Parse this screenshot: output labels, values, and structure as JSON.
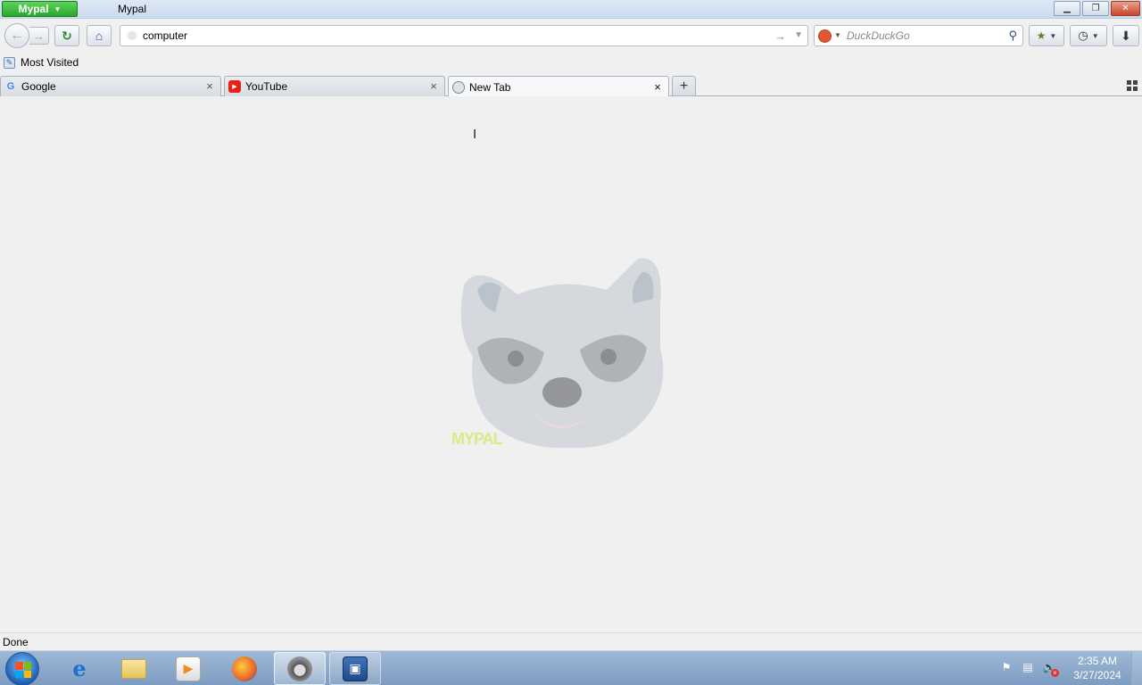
{
  "window": {
    "app_menu_label": "Mypal",
    "title": "Mypal"
  },
  "nav": {
    "url_value": "computer",
    "search_engine": "DuckDuckGo",
    "search_placeholder": "DuckDuckGo"
  },
  "bookmarks": {
    "items": [
      {
        "label": "Most Visited",
        "icon": "bookmark-folder-icon"
      }
    ]
  },
  "tabs": [
    {
      "label": "Google",
      "icon": "google-icon",
      "active": false
    },
    {
      "label": "YouTube",
      "icon": "youtube-icon",
      "active": false
    },
    {
      "label": "New Tab",
      "icon": "globe-icon",
      "active": true
    }
  ],
  "content": {
    "watermark": "MYPAL",
    "mascot": "raccoon-mascot"
  },
  "status": {
    "text": "Done"
  },
  "taskbar": {
    "apps": [
      {
        "name": "internet-explorer-icon",
        "state": "pinned"
      },
      {
        "name": "file-explorer-icon",
        "state": "pinned"
      },
      {
        "name": "media-player-icon",
        "state": "pinned"
      },
      {
        "name": "firefox-icon",
        "state": "pinned"
      },
      {
        "name": "mypal-raccoon-icon",
        "state": "active"
      },
      {
        "name": "virtualbox-icon",
        "state": "running"
      }
    ],
    "tray": [
      "action-center-flag-icon",
      "network-icon",
      "volume-muted-icon"
    ],
    "time": "2:35 AM",
    "date": "3/27/2024"
  },
  "colors": {
    "app_button": "#27a82a",
    "titlebar": "#c9dbef",
    "taskbar": "#7d9cc2",
    "content_bg": "#f0f0f0",
    "close_button": "#c9452a"
  }
}
